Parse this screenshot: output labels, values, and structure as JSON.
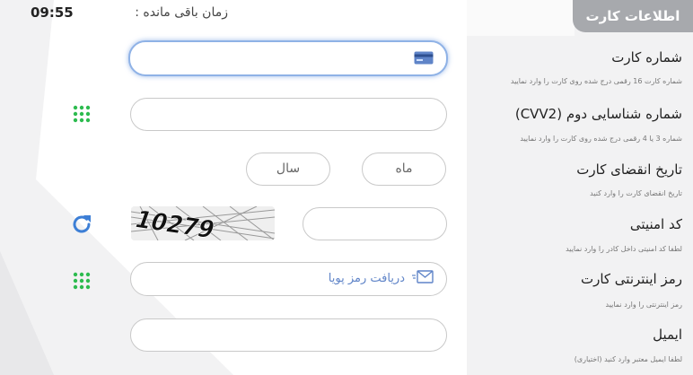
{
  "header": {
    "title": "اطلاعات کارت"
  },
  "timer": {
    "label": "زمان باقی مانده :",
    "value": "09:55"
  },
  "fields": {
    "card_number": {
      "label": "شماره کارت",
      "hint": "شماره کارت 16 رقمی درج شده روی کارت را وارد نمایید",
      "value": "",
      "icon": "credit-card-icon"
    },
    "cvv2": {
      "label": "شماره شناسایی دوم (CVV2)",
      "hint": "شماره 3 یا 4 رقمی درج شده روی کارت را وارد نمایید",
      "value": "",
      "icon": "keypad-icon"
    },
    "expiry": {
      "label": "تاریخ انقضای کارت",
      "hint": "تاریخ انقضای کارت را وارد کنید",
      "month_placeholder": "ماه",
      "year_placeholder": "سال"
    },
    "captcha": {
      "label": "کد امنیتی",
      "hint": "لطفا کد امنیتی داخل کادر را وارد نمایید",
      "value": "",
      "image_text": "10279",
      "icon": "refresh-icon"
    },
    "pin2": {
      "label": "رمز اینترنتی کارت",
      "hint": "رمز اینترنتی را وارد نمایید",
      "otp_button": "دریافت رمز پویا",
      "otp_icon": "envelope-icon",
      "icon": "keypad-icon"
    },
    "email": {
      "label": "ایمیل",
      "hint": "لطفا ایمیل معتبر وارد کنید (اختیاری)",
      "value": ""
    }
  },
  "colors": {
    "accent": "#5f84c8",
    "keypad": "#2dbb4f",
    "refresh": "#3d7fd6",
    "header_bg": "#a7a9ad"
  }
}
